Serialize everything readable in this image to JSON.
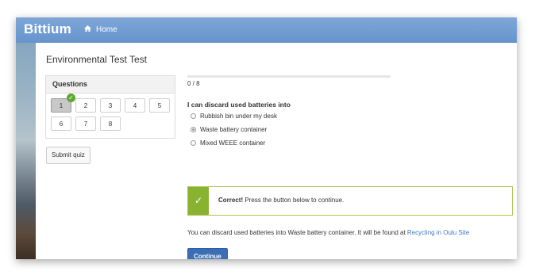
{
  "app": {
    "brand": "Bittium",
    "nav_home": "Home"
  },
  "page": {
    "title": "Environmental Test Test"
  },
  "questions_panel": {
    "header": "Questions",
    "buttons": [
      "1",
      "2",
      "3",
      "4",
      "5",
      "6",
      "7",
      "8"
    ],
    "active": "1",
    "submit_label": "Submit quiz"
  },
  "progress": {
    "text": "0 / 8",
    "fraction": 0
  },
  "question": {
    "text": "I can discard used batteries into",
    "options": [
      "Rubbish bin under my desk",
      "Waste battery container",
      "Mixed WEEE container"
    ],
    "selected_index": 1
  },
  "feedback": {
    "icon": "check-icon",
    "strong": "Correct!",
    "message": " Press the button below to continue."
  },
  "info": {
    "text": "You can discard used batteries into Waste battery container. It will be found at ",
    "link": "Recycling in Oulu Site"
  },
  "continue_label": "Continue",
  "colors": {
    "navbar": "#6694cc",
    "success": "#8ab231",
    "primary_button": "#3a6eb5",
    "link": "#3d78c2"
  }
}
